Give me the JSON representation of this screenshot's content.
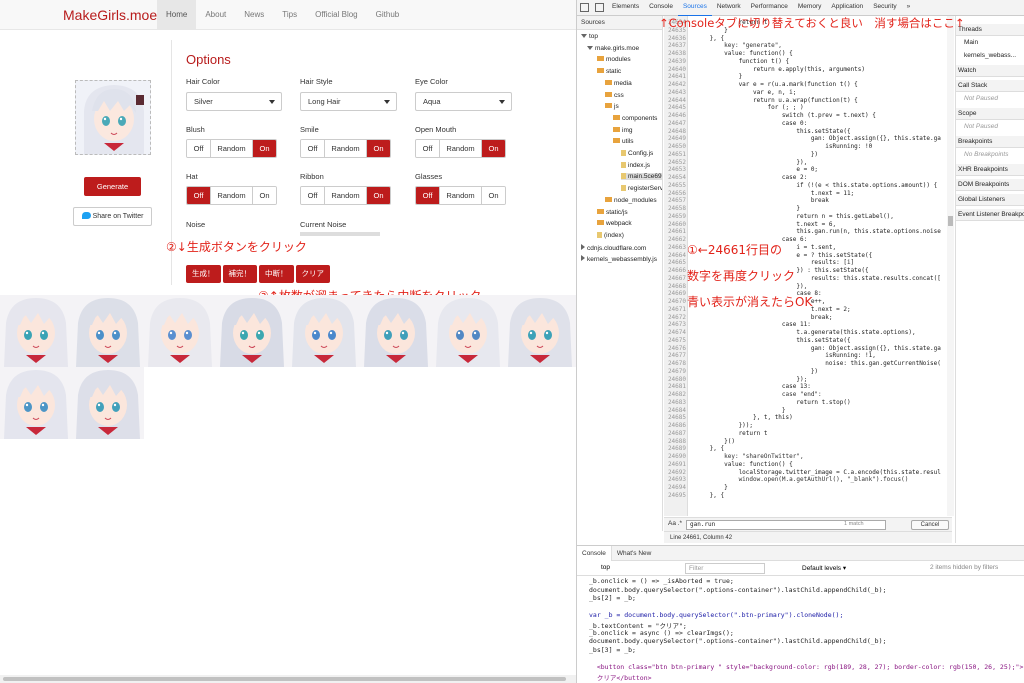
{
  "site": {
    "brand": "MakeGirls.moe",
    "nav": [
      "Home",
      "About",
      "News",
      "Tips",
      "Official Blog",
      "Github"
    ]
  },
  "left": {
    "generate_label": "Generate",
    "twitter_label": "Share on Twitter"
  },
  "options": {
    "title": "Options",
    "hair_color": {
      "label": "Hair Color",
      "value": "Silver"
    },
    "hair_style": {
      "label": "Hair Style",
      "value": "Long Hair"
    },
    "eye_color": {
      "label": "Eye Color",
      "value": "Aqua"
    },
    "blush": {
      "label": "Blush",
      "choices": [
        "Off",
        "Random",
        "On"
      ],
      "selected": "On"
    },
    "smile": {
      "label": "Smile",
      "choices": [
        "Off",
        "Random",
        "On"
      ],
      "selected": "On"
    },
    "open_mouth": {
      "label": "Open Mouth",
      "choices": [
        "Off",
        "Random",
        "On"
      ],
      "selected": "On"
    },
    "hat": {
      "label": "Hat",
      "choices": [
        "Off",
        "Random",
        "On"
      ],
      "selected": "Off"
    },
    "ribbon": {
      "label": "Ribbon",
      "choices": [
        "Off",
        "Random",
        "On"
      ],
      "selected": "On"
    },
    "glasses": {
      "label": "Glasses",
      "choices": [
        "Off",
        "Random",
        "On"
      ],
      "selected": "Off"
    },
    "noise_label": "Noise",
    "current_noise_label": "Current Noise"
  },
  "actions": [
    "生成！",
    "補完！",
    "中断！",
    "クリア"
  ],
  "annotations": {
    "step2": "②↓生成ボタンをクリック",
    "step3": "③↑枚数が溜まってきたら中断をクリック",
    "top": "↑Consoleタブに切り替えておくと良い　消す場合はここ↑",
    "step1_line1": "①←24661行目の",
    "step1_line2": "数字を再度クリック",
    "step1_line3": "青い表示が消えたらOK"
  },
  "thumbnail_count": 10,
  "devtools": {
    "tabs": [
      "Elements",
      "Console",
      "Sources",
      "Network",
      "Performance",
      "Memory",
      "Application",
      "Security",
      "»"
    ],
    "active_tab": "Sources",
    "nav_head": "Sources",
    "tree": [
      {
        "label": "top",
        "kind": "tri-down"
      },
      {
        "label": "make.girls.moe",
        "kind": "tri-down"
      },
      {
        "label": "modules",
        "kind": "folder"
      },
      {
        "label": "static",
        "kind": "folder-open"
      },
      {
        "label": "media",
        "kind": "folder"
      },
      {
        "label": "css",
        "kind": "folder"
      },
      {
        "label": "js",
        "kind": "folder-open"
      },
      {
        "label": "components",
        "kind": "folder"
      },
      {
        "label": "img",
        "kind": "folder"
      },
      {
        "label": "utils",
        "kind": "folder"
      },
      {
        "label": "Config.js",
        "kind": "file"
      },
      {
        "label": "index.js",
        "kind": "file"
      },
      {
        "label": "main.5ce69b",
        "kind": "file-sel"
      },
      {
        "label": "registerServic",
        "kind": "file"
      },
      {
        "label": "node_modules",
        "kind": "folder"
      },
      {
        "label": "static/js",
        "kind": "folder"
      },
      {
        "label": "webpack",
        "kind": "folder"
      },
      {
        "label": "(index)",
        "kind": "file"
      },
      {
        "label": "cdnjs.cloudflare.com",
        "kind": "tri"
      },
      {
        "label": "kernels_webassembly.js",
        "kind": "tri"
      }
    ],
    "code": [
      {
        "n": "24634",
        "t": "              return t"
      },
      {
        "n": "24635",
        "t": "          }"
      },
      {
        "n": "24636",
        "t": "      }, {"
      },
      {
        "n": "24637",
        "t": "          key: \"generate\","
      },
      {
        "n": "24638",
        "t": "          value: function() {"
      },
      {
        "n": "24639",
        "t": "              function t() {"
      },
      {
        "n": "24640",
        "t": "                  return e.apply(this, arguments)"
      },
      {
        "n": "24641",
        "t": "              }"
      },
      {
        "n": "24642",
        "t": "              var e = r(u.a.mark(function t() {"
      },
      {
        "n": "24643",
        "t": "                  var e, n, i;"
      },
      {
        "n": "24644",
        "t": "                  return u.a.wrap(function(t) {"
      },
      {
        "n": "24645",
        "t": "                      for (; ; )"
      },
      {
        "n": "24646",
        "t": "                          switch (t.prev = t.next) {"
      },
      {
        "n": "24647",
        "t": "                          case 0:"
      },
      {
        "n": "24648",
        "t": "                              this.setState({"
      },
      {
        "n": "24649",
        "t": "                                  gan: Object.assign({}, this.state.ga"
      },
      {
        "n": "24650",
        "t": "                                      isRunning: !0"
      },
      {
        "n": "24651",
        "t": "                                  })"
      },
      {
        "n": "24652",
        "t": "                              }),"
      },
      {
        "n": "24653",
        "t": "                              e = 0;"
      },
      {
        "n": "24654",
        "t": "                          case 2:"
      },
      {
        "n": "24655",
        "t": "                              if (!(e < this.state.options.amount)) {"
      },
      {
        "n": "24656",
        "t": "                                  t.next = 11;"
      },
      {
        "n": "24657",
        "t": "                                  break"
      },
      {
        "n": "24658",
        "t": "                              }"
      },
      {
        "n": "24659",
        "t": "                              return n = this.getLabel(),"
      },
      {
        "n": "24660",
        "t": "                              t.next = 6,"
      },
      {
        "n": "24661",
        "t": "                              this.gan.run(n, this.state.options.noise"
      },
      {
        "n": "24662",
        "t": "                          case 6:"
      },
      {
        "n": "24663",
        "t": "                              i = t.sent,"
      },
      {
        "n": "24664",
        "t": "                              e = ? this.setState({"
      },
      {
        "n": "24665",
        "t": "                                  results: [i]"
      },
      {
        "n": "24666",
        "t": "                              }) : this.setState({"
      },
      {
        "n": "24667",
        "t": "                                  results: this.state.results.concat(["
      },
      {
        "n": "24668",
        "t": "                              }),"
      },
      {
        "n": "24669",
        "t": "                              case 8:"
      },
      {
        "n": "24670",
        "t": "                                  e++,"
      },
      {
        "n": "24671",
        "t": "                                  t.next = 2;"
      },
      {
        "n": "24672",
        "t": "                                  break;"
      },
      {
        "n": "24673",
        "t": "                          case 11:"
      },
      {
        "n": "24674",
        "t": "                              t.a.generate(this.state.options),"
      },
      {
        "n": "24675",
        "t": "                              this.setState({"
      },
      {
        "n": "24676",
        "t": "                                  gan: Object.assign({}, this.state.ga"
      },
      {
        "n": "24677",
        "t": "                                      isRunning: !1,"
      },
      {
        "n": "24678",
        "t": "                                      noise: this.gan.getCurrentNoise("
      },
      {
        "n": "24679",
        "t": "                                  })"
      },
      {
        "n": "24680",
        "t": "                              });"
      },
      {
        "n": "24681",
        "t": "                          case 13:"
      },
      {
        "n": "24682",
        "t": "                          case \"end\":"
      },
      {
        "n": "24683",
        "t": "                              return t.stop()"
      },
      {
        "n": "24684",
        "t": "                          }"
      },
      {
        "n": "24685",
        "t": "                  }, t, this)"
      },
      {
        "n": "24686",
        "t": "              }));"
      },
      {
        "n": "24687",
        "t": "              return t"
      },
      {
        "n": "24688",
        "t": "          }()"
      },
      {
        "n": "24689",
        "t": "      }, {"
      },
      {
        "n": "24690",
        "t": "          key: \"shareOnTwitter\","
      },
      {
        "n": "24691",
        "t": "          value: function() {"
      },
      {
        "n": "24692",
        "t": "              localStorage.twitter_image = C.a.encode(this.state.resul"
      },
      {
        "n": "24693",
        "t": "              window.open(M.a.getAuthUrl(), \"_blank\").focus()"
      },
      {
        "n": "24694",
        "t": "          }"
      },
      {
        "n": "24695",
        "t": "      }, {"
      }
    ],
    "search": {
      "query": "gan.run",
      "match": "1 match",
      "cancel": "Cancel",
      "aa": "Aa  .*"
    },
    "status": "Line 24661, Column 42",
    "side": [
      {
        "head": "Threads",
        "body": [
          "Main",
          "kernels_webass..."
        ],
        "plain": true
      },
      {
        "head": "Watch",
        "body": [],
        "plain": true
      },
      {
        "head": "Call Stack",
        "body": [
          "Not Paused"
        ],
        "plain": false
      },
      {
        "head": "Scope",
        "body": [
          "Not Paused"
        ],
        "plain": false
      },
      {
        "head": "Breakpoints",
        "body": [
          "No Breakpoints"
        ],
        "plain": false
      },
      {
        "head": "XHR Breakpoints",
        "body": [],
        "plain": true
      },
      {
        "head": "DOM Breakpoints",
        "body": [],
        "plain": true
      },
      {
        "head": "Global Listeners",
        "body": [],
        "plain": true
      },
      {
        "head": "Event Listener Breakpoints",
        "body": [],
        "plain": true
      }
    ],
    "console": {
      "tabs": [
        "Console",
        "What's New"
      ],
      "context": "top",
      "filter_placeholder": "Filter",
      "levels": "Default levels ▾",
      "hidden": "2 items hidden by filters",
      "lines": [
        {
          "t": "_b.onclick = () => _isAborted = true;",
          "c": ""
        },
        {
          "t": "document.body.querySelector(\".options-container\").lastChild.appendChild(_b);",
          "c": ""
        },
        {
          "t": "_bs[2] = _b;",
          "c": ""
        },
        {
          "t": "",
          "c": ""
        },
        {
          "t": "var _b = document.body.querySelector(\".btn-primary\").cloneNode();",
          "c": "blue"
        },
        {
          "t": "_b.textContent = \"クリア\";",
          "c": ""
        },
        {
          "t": "_b.onclick = async () => clearImgs();",
          "c": ""
        },
        {
          "t": "document.body.querySelector(\".options-container\").lastChild.appendChild(_b);",
          "c": ""
        },
        {
          "t": "_bs[3] = _b;",
          "c": ""
        },
        {
          "t": "",
          "c": ""
        },
        {
          "t": "  <button class=\"btn btn-primary \" style=\"background-color: rgb(189, 28, 27); border-color: rgb(150, 26, 25);\">",
          "c": "tag"
        },
        {
          "t": "  クリア</button>",
          "c": "tag"
        }
      ]
    }
  }
}
